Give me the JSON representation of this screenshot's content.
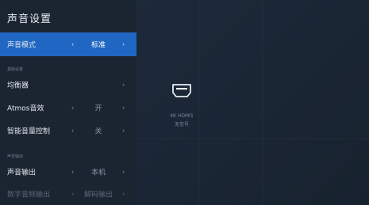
{
  "panel": {
    "title": "声音设置"
  },
  "rows": {
    "sound_mode": {
      "label": "声音模式",
      "value": "标准"
    },
    "equalizer": {
      "label": "均衡器"
    },
    "atmos": {
      "label": "Atmos音效",
      "value": "开"
    },
    "smart_volume": {
      "label": "智能音量控制",
      "value": "关"
    },
    "sound_output": {
      "label": "声音输出",
      "value": "本机"
    },
    "digital_audio_output": {
      "label": "数字音频输出",
      "value": "解码输出"
    }
  },
  "sections": {
    "basic": "基础设置",
    "output": "声音输出"
  },
  "arrows": {
    "left": "‹",
    "right": "›"
  },
  "source": {
    "icon": "hdmi-port-icon",
    "name": "4K HDMI1",
    "status": "无信号"
  },
  "colors": {
    "accent": "#1f67c3",
    "panel_bg": "#1b2532",
    "background": "#1a2433"
  }
}
